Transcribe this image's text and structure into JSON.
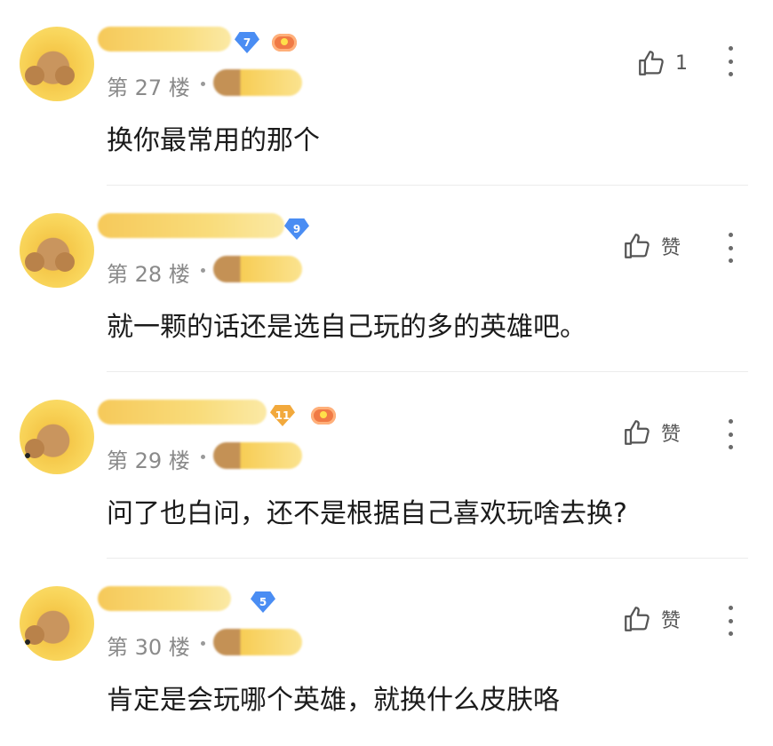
{
  "comments": [
    {
      "floor": "第 27 楼",
      "content": "换你最常用的那个",
      "level": "7",
      "level_color": "blue",
      "has_game_icon": true,
      "like_label": "1"
    },
    {
      "floor": "第 28 楼",
      "content": "就一颗的话还是选自己玩的多的英雄吧。",
      "level": "9",
      "level_color": "blue",
      "has_game_icon": false,
      "like_label": "赞"
    },
    {
      "floor": "第 29 楼",
      "content": "问了也白问，还不是根据自己喜欢玩啥去换?",
      "level": "11",
      "level_color": "gold",
      "has_game_icon": true,
      "like_label": "赞"
    },
    {
      "floor": "第 30 楼",
      "content": "肯定是会玩哪个英雄，就换什么皮肤咯",
      "level": "5",
      "level_color": "blue",
      "has_game_icon": false,
      "like_label": "赞"
    }
  ],
  "icons": {
    "like": "thumbs-up-icon",
    "more": "more-vertical-icon",
    "game": "game-controller-icon"
  },
  "colors": {
    "badge_blue": "#4a8df3",
    "badge_gold": "#f2a93c",
    "text": "#1b1b1b",
    "meta": "#8a8a8a"
  }
}
